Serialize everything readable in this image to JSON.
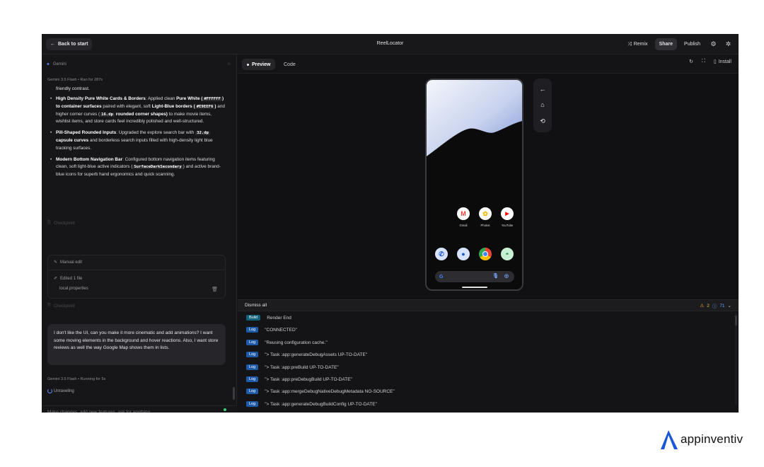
{
  "topbar": {
    "back_label": "Back to start",
    "title": "ReelLocator",
    "remix_label": "Remix",
    "share_label": "Share",
    "publish_label": "Publish"
  },
  "left": {
    "header": "Gemini",
    "meta_top": "Gemini 3.5 Flash  •  Ran for 287s",
    "fragment": "friendly contrast.",
    "bullets": [
      {
        "title": "High Density Pure White Cards & Borders",
        "parts": [
          ": Applied clean ",
          "Pure White (",
          "#FFFFFF",
          ") to container surfaces",
          " paired with elegant, soft ",
          "Light-Blue borders (",
          "#E9EEF6",
          ")",
          " and higher corner curves (",
          "16.dp",
          " rounded corner shapes)",
          " to make movie items, wishlist items, and store cards feel incredibly polished and well-structured."
        ]
      },
      {
        "title": "Pill-Shaped Rounded Inputs",
        "parts": [
          ": Upgraded the explore search bar with ",
          "32.dp",
          " capsule curves",
          " and borderless search inputs filled with high-density light blue tracking surfaces."
        ]
      },
      {
        "title": "Modern Bottom Navigation Bar",
        "parts": [
          ": Configured bottom navigation items featuring clean, soft light-blue active indicators (",
          "SurfaceDarkSecondary",
          ") and active brand-blue icons for superb hand ergonomics and quick scanning."
        ]
      }
    ],
    "checkpoint_label": "Checkpoint",
    "manual_edit_label": "Manual edit",
    "edited_label": "Edited 1 file",
    "file_name": "local.properties",
    "user_message": "I don't like the UI, can you make it more cinematic and add animations? I want some moving elements in the background and hover reactions. Also, I want store reviews as well the way Google Map shows them in lists.",
    "meta_bottom": "Gemini 3.5 Flash  •  Running for 5s",
    "status": "Unraveling",
    "prompt_placeholder": "Make changes, add new features, ask for anything"
  },
  "preview": {
    "tab_preview": "Preview",
    "tab_code": "Code",
    "install_label": "Install",
    "apps": [
      {
        "name": "Gmail",
        "glyph": "M",
        "bg": "#ffffff",
        "fg": "#ea4335"
      },
      {
        "name": "Photos",
        "glyph": "✿",
        "bg": "#ffffff",
        "fg": "#fbbc04"
      },
      {
        "name": "YouTube",
        "glyph": "▶",
        "bg": "#ffffff",
        "fg": "#ff0000"
      }
    ],
    "search_glyph": "G"
  },
  "console": {
    "dismiss_label": "Dismiss all",
    "warn_count": "2",
    "info_count": "71",
    "rows": [
      {
        "tag": "Build",
        "text": "Render End"
      },
      {
        "tag": "Log",
        "text": "\"CONNECTED\""
      },
      {
        "tag": "Log",
        "text": "\"Reusing configuration cache.\""
      },
      {
        "tag": "Log",
        "text": "\"> Task :app:generateDebugAssets UP-TO-DATE\""
      },
      {
        "tag": "Log",
        "text": "\"> Task :app:preBuild UP-TO-DATE\""
      },
      {
        "tag": "Log",
        "text": "\"> Task :app:preDebugBuild UP-TO-DATE\""
      },
      {
        "tag": "Log",
        "text": "\"> Task :app:mergeDebugNativeDebugMetadata NO-SOURCE\""
      },
      {
        "tag": "Log",
        "text": "\"> Task :app:generateDebugBuildConfig UP-TO-DATE\""
      }
    ]
  },
  "brand": {
    "name": "appinventiv"
  },
  "colors": {
    "accent": "#5b8cff",
    "brand": "#1a57d6"
  }
}
